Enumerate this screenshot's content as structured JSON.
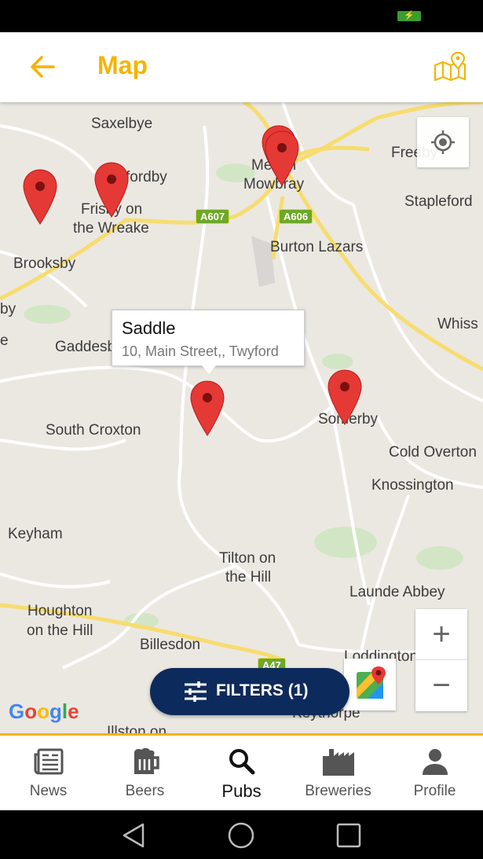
{
  "app_bar": {
    "title": "Map"
  },
  "map": {
    "places": {
      "saxelbye": "Saxelbye",
      "asfordby": "fordby",
      "frisby": "Frisby on",
      "frisby2": "the Wreake",
      "melton": "Melton",
      "melton2": "Mowbray",
      "freeby": "Freeby",
      "stapleford": "Stapleford",
      "burton": "Burton Lazars",
      "brooksby": "Brooksby",
      "whissendine": "Whiss",
      "gaddesby": "Gaddesb",
      "south_croxton": "South Croxton",
      "somerby": "Somerby",
      "cold_overton": "Cold Overton",
      "knossington": "Knossington",
      "keyham": "Keyham",
      "tilton": "Tilton on",
      "tilton2": "the Hill",
      "launde": "Launde Abbey",
      "houghton": "Houghton",
      "houghton2": "on the Hill",
      "billesdon": "Billesdon",
      "loddington": "Loddington",
      "keythorpe": "Keythorpe",
      "illston": "Illston on",
      "edge1": "by",
      "edge2": "e"
    },
    "roads": {
      "a607": "A607",
      "a606": "A606",
      "a47": "A47"
    },
    "info_window": {
      "title": "Saddle",
      "address": "10, Main Street,, Twyford"
    },
    "zoom_in": "+",
    "zoom_out": "−",
    "filters_label": "FILTERS (1)",
    "attribution": [
      "G",
      "o",
      "o",
      "g",
      "l",
      "e"
    ]
  },
  "nav": {
    "items": [
      {
        "label": "News",
        "icon": "newspaper-icon"
      },
      {
        "label": "Beers",
        "icon": "beer-mug-icon"
      },
      {
        "label": "Pubs",
        "icon": "search-icon"
      },
      {
        "label": "Breweries",
        "icon": "factory-icon"
      },
      {
        "label": "Profile",
        "icon": "person-icon"
      }
    ],
    "active": "Pubs"
  },
  "colors": {
    "accent": "#f5b400",
    "filters_button": "#0d2a5c",
    "pin": "#e53935",
    "map_background": "#ebe8e2"
  }
}
